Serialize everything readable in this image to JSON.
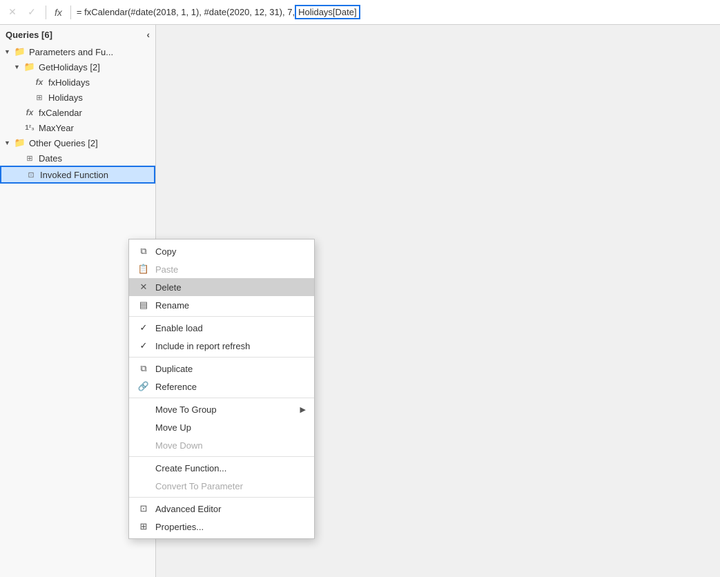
{
  "formulaBar": {
    "cancelLabel": "✕",
    "confirmLabel": "✓",
    "fxLabel": "fx",
    "formulaText": "= fxCalendar(#date(2018, 1, 1), #date(2020, 12, 31), 7, ",
    "formulaHighlight": "Holidays[Date]"
  },
  "sidebar": {
    "title": "Queries [6]",
    "collapseLabel": "‹",
    "items": [
      {
        "id": "parameters-fu",
        "label": "Parameters and Fu...",
        "type": "folder",
        "indent": 0,
        "expanded": true
      },
      {
        "id": "get-holidays",
        "label": "GetHolidays [2]",
        "type": "folder",
        "indent": 1,
        "expanded": true
      },
      {
        "id": "fx-holidays",
        "label": "fxHolidays",
        "type": "fx",
        "indent": 2
      },
      {
        "id": "holidays",
        "label": "Holidays",
        "type": "table",
        "indent": 2
      },
      {
        "id": "fx-calendar",
        "label": "fxCalendar",
        "type": "fx",
        "indent": 1
      },
      {
        "id": "max-year",
        "label": "MaxYear",
        "type": "param",
        "indent": 1
      },
      {
        "id": "other-queries",
        "label": "Other Queries [2]",
        "type": "folder",
        "indent": 0,
        "expanded": true
      },
      {
        "id": "dates",
        "label": "Dates",
        "type": "table",
        "indent": 1
      },
      {
        "id": "invoked-function",
        "label": "Invoked Function",
        "type": "invoked",
        "indent": 1,
        "selected": true
      }
    ]
  },
  "contextMenu": {
    "items": [
      {
        "id": "copy",
        "label": "Copy",
        "icon": "copy",
        "disabled": false
      },
      {
        "id": "paste",
        "label": "Paste",
        "icon": "paste",
        "disabled": true
      },
      {
        "id": "delete",
        "label": "Delete",
        "icon": "delete-x",
        "disabled": false,
        "highlighted": true
      },
      {
        "id": "rename",
        "label": "Rename",
        "icon": "rename",
        "disabled": false
      },
      {
        "id": "sep1",
        "type": "separator"
      },
      {
        "id": "enable-load",
        "label": "Enable load",
        "icon": "check",
        "disabled": false
      },
      {
        "id": "include-refresh",
        "label": "Include in report refresh",
        "icon": "check",
        "disabled": false
      },
      {
        "id": "sep2",
        "type": "separator"
      },
      {
        "id": "duplicate",
        "label": "Duplicate",
        "icon": "duplicate",
        "disabled": false
      },
      {
        "id": "reference",
        "label": "Reference",
        "icon": "reference",
        "disabled": false
      },
      {
        "id": "sep3",
        "type": "separator"
      },
      {
        "id": "move-to-group",
        "label": "Move To Group",
        "icon": "",
        "hasArrow": true,
        "disabled": false
      },
      {
        "id": "move-up",
        "label": "Move Up",
        "icon": "",
        "disabled": false
      },
      {
        "id": "move-down",
        "label": "Move Down",
        "icon": "",
        "disabled": true
      },
      {
        "id": "sep4",
        "type": "separator"
      },
      {
        "id": "create-function",
        "label": "Create Function...",
        "icon": "",
        "disabled": false
      },
      {
        "id": "convert-to-param",
        "label": "Convert To Parameter",
        "icon": "",
        "disabled": true
      },
      {
        "id": "sep5",
        "type": "separator"
      },
      {
        "id": "advanced-editor",
        "label": "Advanced Editor",
        "icon": "adv-editor",
        "disabled": false
      },
      {
        "id": "properties",
        "label": "Properties...",
        "icon": "properties",
        "disabled": false
      }
    ]
  }
}
